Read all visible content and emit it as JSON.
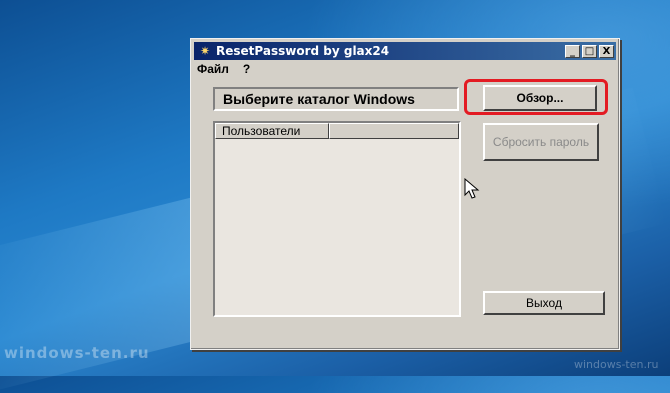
{
  "window": {
    "title": "ResetPassword by glax24",
    "controls": {
      "minimize": "_",
      "maximize": "□",
      "close": "X"
    }
  },
  "menu": {
    "items": [
      "Файл",
      "?"
    ]
  },
  "path_field": {
    "value": "Выберите каталог Windows"
  },
  "buttons": {
    "browse": "Обзор...",
    "reset": "Сбросить пароль",
    "exit": "Выход"
  },
  "list": {
    "columns": [
      "Пользователи",
      ""
    ]
  },
  "colors": {
    "highlight": "#e31b23",
    "titlebar": "#0a246a"
  },
  "watermarks": {
    "left": "windows-ten.ru",
    "right": "windows-ten.ru"
  }
}
